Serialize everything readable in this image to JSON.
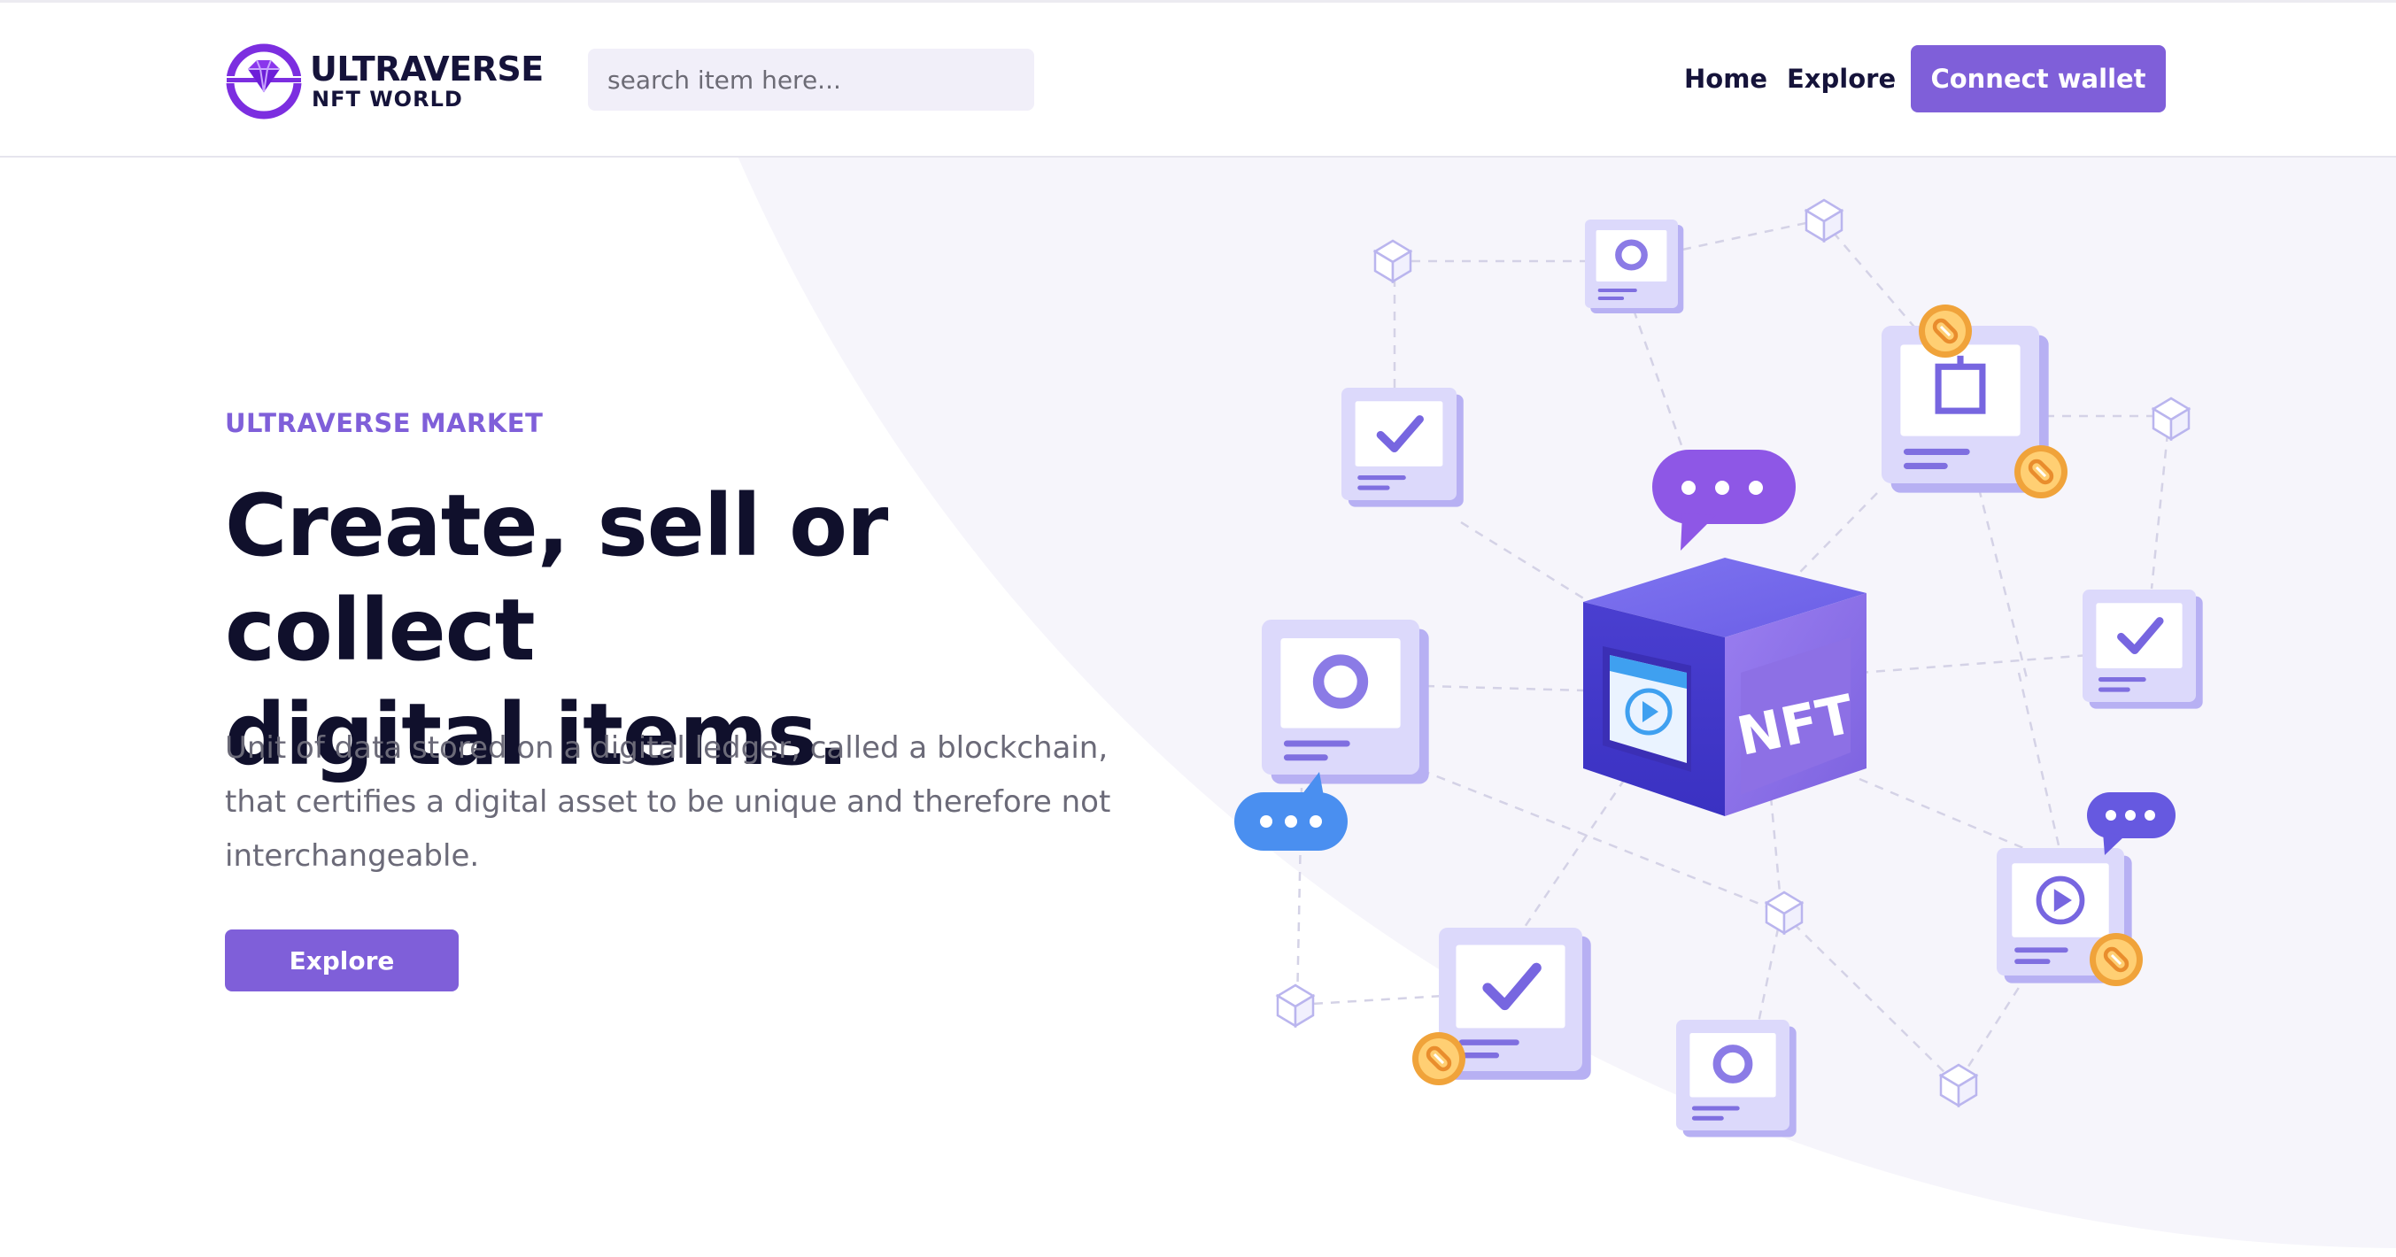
{
  "header": {
    "logo": {
      "title": "ULTRAVERSE",
      "subtitle": "NFT WORLD"
    },
    "search": {
      "placeholder": "search item here..."
    },
    "nav": [
      {
        "label": "Home"
      },
      {
        "label": "Explore"
      }
    ],
    "connect_label": "Connect wallet"
  },
  "hero": {
    "eyebrow": "ULTRAVERSE MARKET",
    "headline_line1": "Create, sell or collect",
    "headline_line2": "digital items.",
    "description": "Unit of data stored on a digital ledger, called a blockchain, that certifies a digital asset to be unique and therefore not interchangeable.",
    "cta_label": "Explore"
  },
  "illustration": {
    "center_label": "NFT",
    "colors": {
      "accent": "#7f5fd9",
      "cube": "#5b4fd6",
      "card": "#dcd9fb",
      "coin": "#f3a93a",
      "bubble_blue": "#4a8ff0",
      "bg_circle": "#f6f5fb"
    }
  }
}
